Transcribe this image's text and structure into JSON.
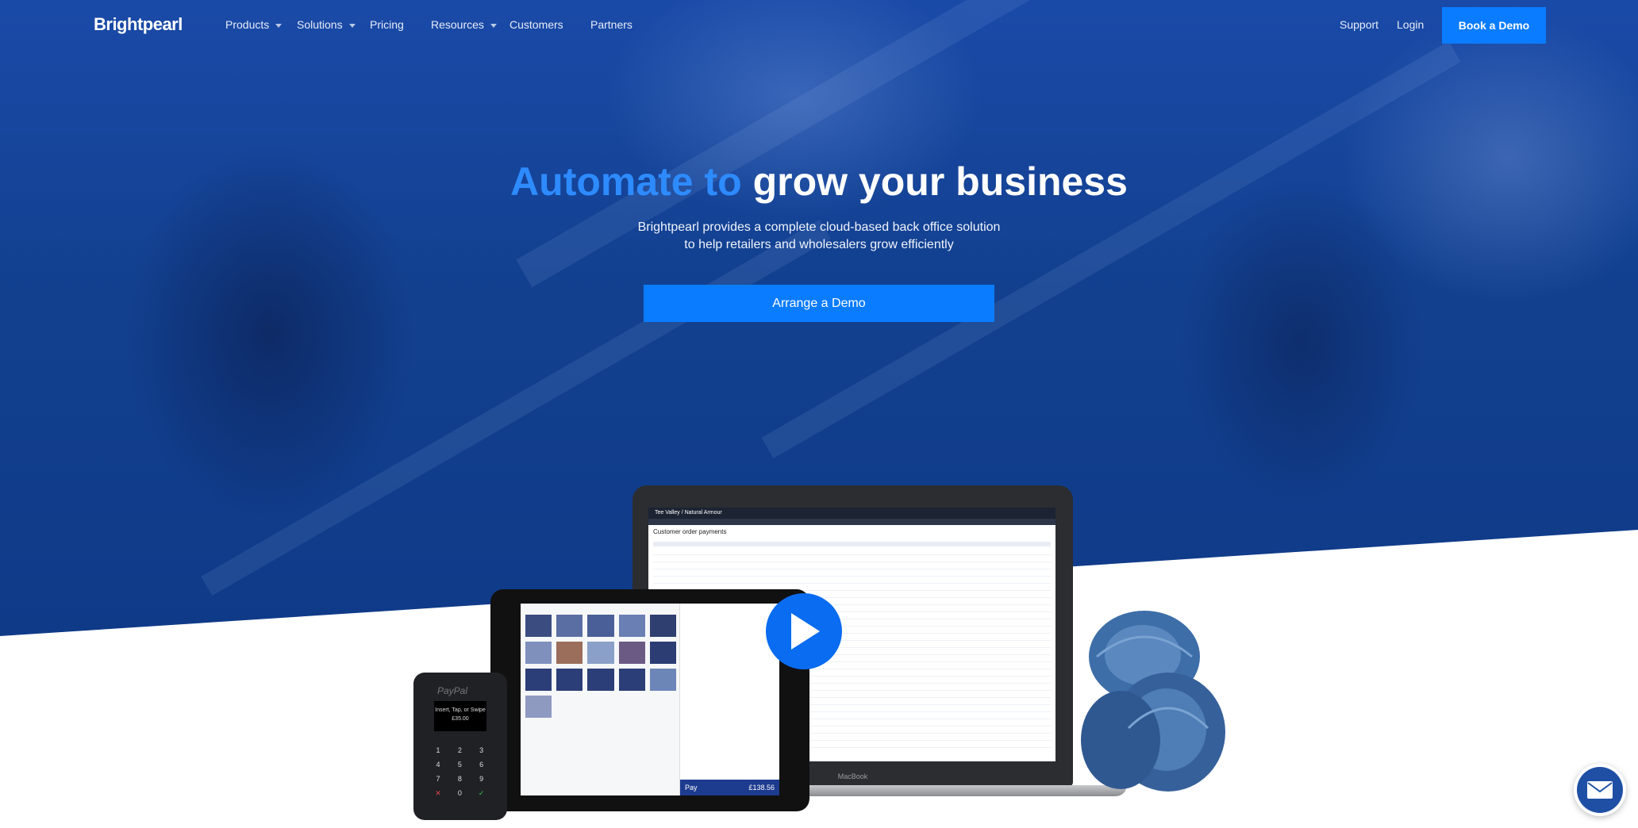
{
  "brand": {
    "logo_text": "Brightpearl",
    "accent": "#0a7cff",
    "hero_blue": "#12408f"
  },
  "nav": {
    "items": [
      {
        "label": "Products",
        "has_dropdown": true
      },
      {
        "label": "Solutions",
        "has_dropdown": true
      },
      {
        "label": "Pricing",
        "has_dropdown": false
      },
      {
        "label": "Resources",
        "has_dropdown": true
      },
      {
        "label": "Customers",
        "has_dropdown": false
      },
      {
        "label": "Partners",
        "has_dropdown": false
      }
    ],
    "support_label": "Support",
    "login_label": "Login",
    "book_demo_label": "Book a Demo"
  },
  "hero": {
    "headline_accent": "Automate to",
    "headline_rest": "grow your business",
    "subtext_line1": "Brightpearl provides a complete cloud-based back office solution",
    "subtext_line2": "to help retailers and wholesalers grow efficiently",
    "cta_label": "Arrange a Demo"
  },
  "laptop": {
    "app_title": "Tee Valley / Natural Armour",
    "screen_title": "Customer order payments",
    "brand_label": "MacBook"
  },
  "tablet": {
    "pay_label": "Pay",
    "pay_amount": "£138.56"
  },
  "card_reader": {
    "brand": "PayPal",
    "display_line1": "Insert, Tap, or Swipe",
    "display_line2": "£35.00",
    "keys": [
      "1",
      "2",
      "3",
      "4",
      "5",
      "6",
      "7",
      "8",
      "9",
      "✕",
      "0",
      "✓"
    ]
  },
  "icons": {
    "play": "play-icon",
    "mail": "mail-icon",
    "caret": "chevron-down-icon"
  }
}
